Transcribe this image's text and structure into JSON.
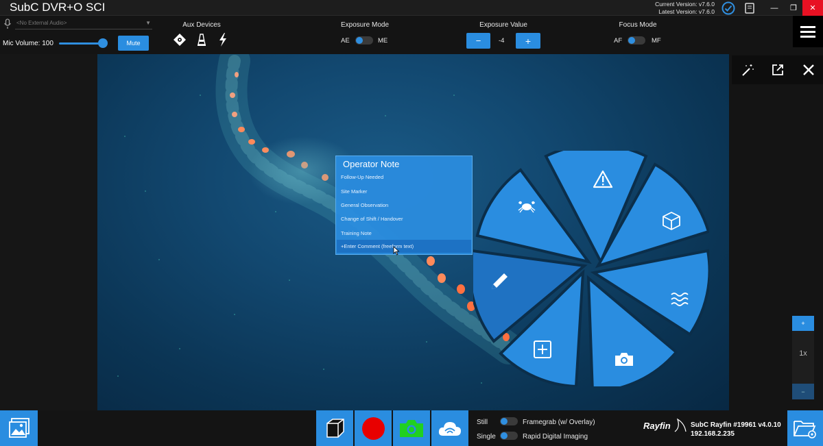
{
  "app": {
    "title": "SubC DVR+O SCI",
    "current_version": "Current Version: v7.6.0",
    "latest_version": "Latest Version: v7.6.0"
  },
  "window_controls": {
    "minimize": "—",
    "restore": "❐",
    "close": "✕"
  },
  "audio": {
    "external_placeholder": "<No External Audio>",
    "mic_volume_label": "Mic Volume: 100",
    "mic_volume": 100,
    "mute_label": "Mute"
  },
  "aux_devices": {
    "title": "Aux Devices",
    "icons": [
      "laser-icon",
      "light-icon",
      "strobe-icon"
    ]
  },
  "exposure_mode": {
    "title": "Exposure Mode",
    "left": "AE",
    "right": "ME",
    "value": "AE"
  },
  "exposure_value": {
    "title": "Exposure Value",
    "minus": "−",
    "value": "-4",
    "plus": "+"
  },
  "focus_mode": {
    "title": "Focus Mode",
    "left": "AF",
    "right": "MF",
    "value": "AF"
  },
  "operator_note": {
    "title": "Operator Note",
    "items": [
      "Follow-Up Needed",
      "Site Marker",
      "General Observation",
      "Change of Shift / Handover",
      "Training Note",
      "+Enter Comment (freeform text)"
    ],
    "selected_index": 5
  },
  "radial_menu": {
    "segments": [
      "crab-icon",
      "warning-icon",
      "cube-icon",
      "waves-icon",
      "camera-icon",
      "add-icon",
      "pencil-icon"
    ],
    "active": "pencil-icon"
  },
  "zoom": {
    "plus": "+",
    "level": "1x",
    "minus": "−"
  },
  "capture": {
    "still_label": "Still",
    "single_label": "Single",
    "framegrab_label": "Framegrab (w/ Overlay)",
    "rapid_label": "Rapid Digital Imaging"
  },
  "device": {
    "logo": "Rayfin",
    "name": "SubC Rayfin #19961 v4.0.10",
    "ip": "192.168.2.235"
  },
  "colors": {
    "accent": "#2a8de0",
    "record": "#e80000",
    "snapshot": "#20d020",
    "close": "#e81123"
  }
}
